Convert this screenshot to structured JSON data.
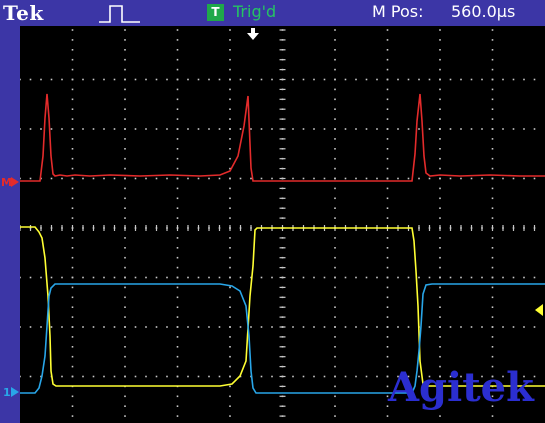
{
  "header": {
    "brand": "Tek",
    "run_icon": "square-pulse-icon",
    "trigger": {
      "box_letter": "T",
      "text": "Trig'd",
      "color": "#25c463"
    },
    "mpos": {
      "label": "M Pos:",
      "value": "560.0µs"
    }
  },
  "markers": {
    "trigger_position_icon": "down-arrow-icon",
    "math_channel": "M",
    "channel1": "1",
    "trigger_level_icon": "left-arrow-icon"
  },
  "colors": {
    "background": "#3c36a6",
    "screen": "#000000",
    "math_trace": "#e32b2b",
    "ch1_trace": "#ffff33",
    "ch2_trace": "#29a6e8",
    "grid": "#c8c8c8"
  },
  "traces": [
    {
      "id": "math-trace",
      "color_key": "math_trace"
    },
    {
      "id": "ch1-trace",
      "color_key": "ch1_trace"
    },
    {
      "id": "ch2-trace",
      "color_key": "ch2_trace"
    }
  ],
  "watermark": "Agitek"
}
